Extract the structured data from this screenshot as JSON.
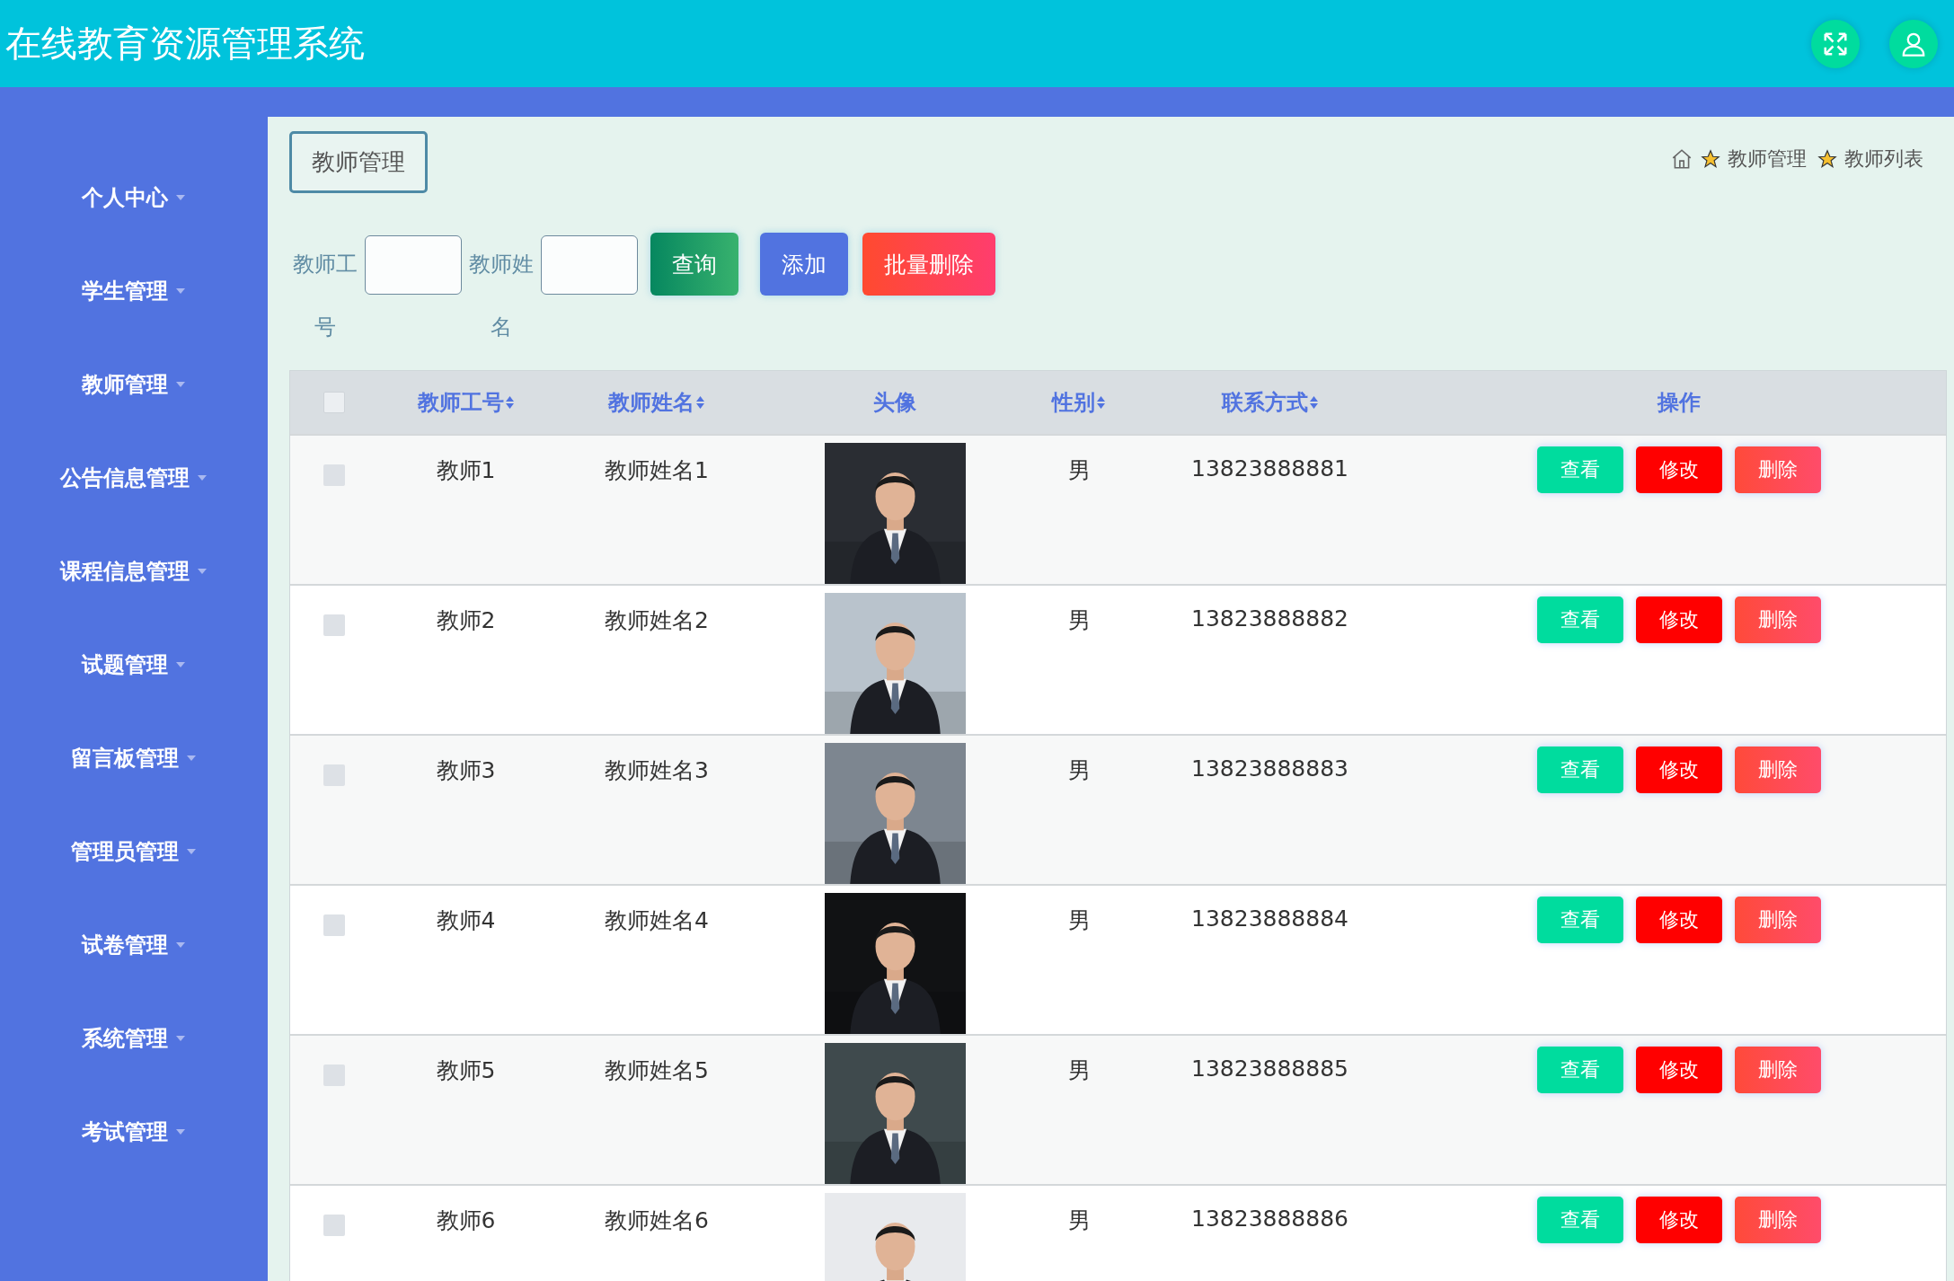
{
  "header": {
    "title": "在线教育资源管理系统"
  },
  "sidebar": {
    "items": [
      "个人中心",
      "学生管理",
      "教师管理",
      "公告信息管理",
      "课程信息管理",
      "试题管理",
      "留言板管理",
      "管理员管理",
      "试卷管理",
      "系统管理",
      "考试管理"
    ]
  },
  "page_title": "教师管理",
  "breadcrumb": [
    "教师管理",
    "教师列表"
  ],
  "search": {
    "fields": [
      {
        "label": "教师工号"
      },
      {
        "label": "教师姓名"
      }
    ],
    "buttons": [
      {
        "label": "查询",
        "kind": "query"
      },
      {
        "label": "添加",
        "kind": "add"
      },
      {
        "label": "批量删除",
        "kind": "delete"
      }
    ]
  },
  "table": {
    "select_all": {
      "checked": false
    },
    "columns": [
      {
        "label": "教师工号",
        "sortable": true
      },
      {
        "label": "教师姓名",
        "sortable": true
      },
      {
        "label": "头像",
        "sortable": false
      },
      {
        "label": "性别",
        "sortable": true
      },
      {
        "label": "联系方式",
        "sortable": true
      },
      {
        "label": "操作",
        "sortable": false
      }
    ],
    "rows": [
      {
        "checked": false,
        "id": "教师1",
        "name": "教师姓名1",
        "gender": "男",
        "phone": "13823888881",
        "actions": [
          "查看",
          "修改",
          "删除"
        ]
      },
      {
        "checked": false,
        "id": "教师2",
        "name": "教师姓名2",
        "gender": "男",
        "phone": "13823888882",
        "actions": [
          "查看",
          "修改",
          "删除"
        ]
      },
      {
        "checked": false,
        "id": "教师3",
        "name": "教师姓名3",
        "gender": "男",
        "phone": "13823888883",
        "actions": [
          "查看",
          "修改",
          "删除"
        ]
      },
      {
        "checked": false,
        "id": "教师4",
        "name": "教师姓名4",
        "gender": "男",
        "phone": "13823888884",
        "actions": [
          "查看",
          "修改",
          "删除"
        ]
      },
      {
        "checked": false,
        "id": "教师5",
        "name": "教师姓名5",
        "gender": "男",
        "phone": "13823888885",
        "actions": [
          "查看",
          "修改",
          "删除"
        ]
      },
      {
        "checked": false,
        "id": "教师6",
        "name": "教师姓名6",
        "gender": "男",
        "phone": "13823888886",
        "actions": [
          "查看",
          "修改",
          "删除"
        ]
      }
    ]
  }
}
